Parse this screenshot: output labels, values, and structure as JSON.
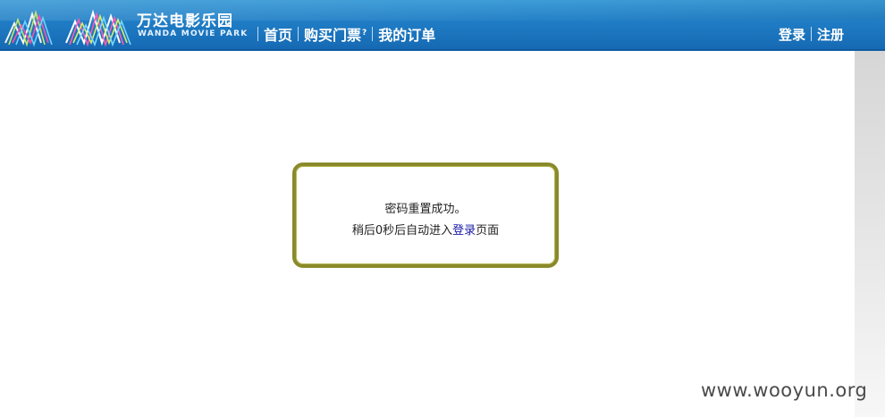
{
  "header": {
    "brand_cn": "万达电影乐园",
    "brand_en": "WANDA MOVIE PARK",
    "nav": [
      {
        "label": "首页"
      },
      {
        "label": "购买门票",
        "sup": "?"
      },
      {
        "label": "我的订单"
      }
    ],
    "auth": {
      "login_label": "登录",
      "register_label": "注册"
    }
  },
  "message": {
    "line1": "密码重置成功。",
    "line2_prefix": "稍后0秒后自动进入",
    "link_label": "登录",
    "line2_suffix": "页面"
  },
  "watermark": "www.wooyun.org",
  "colors": {
    "header_blue": "#1f7cc4",
    "box_border": "#8a8a2a",
    "link": "#1a1aa6"
  }
}
